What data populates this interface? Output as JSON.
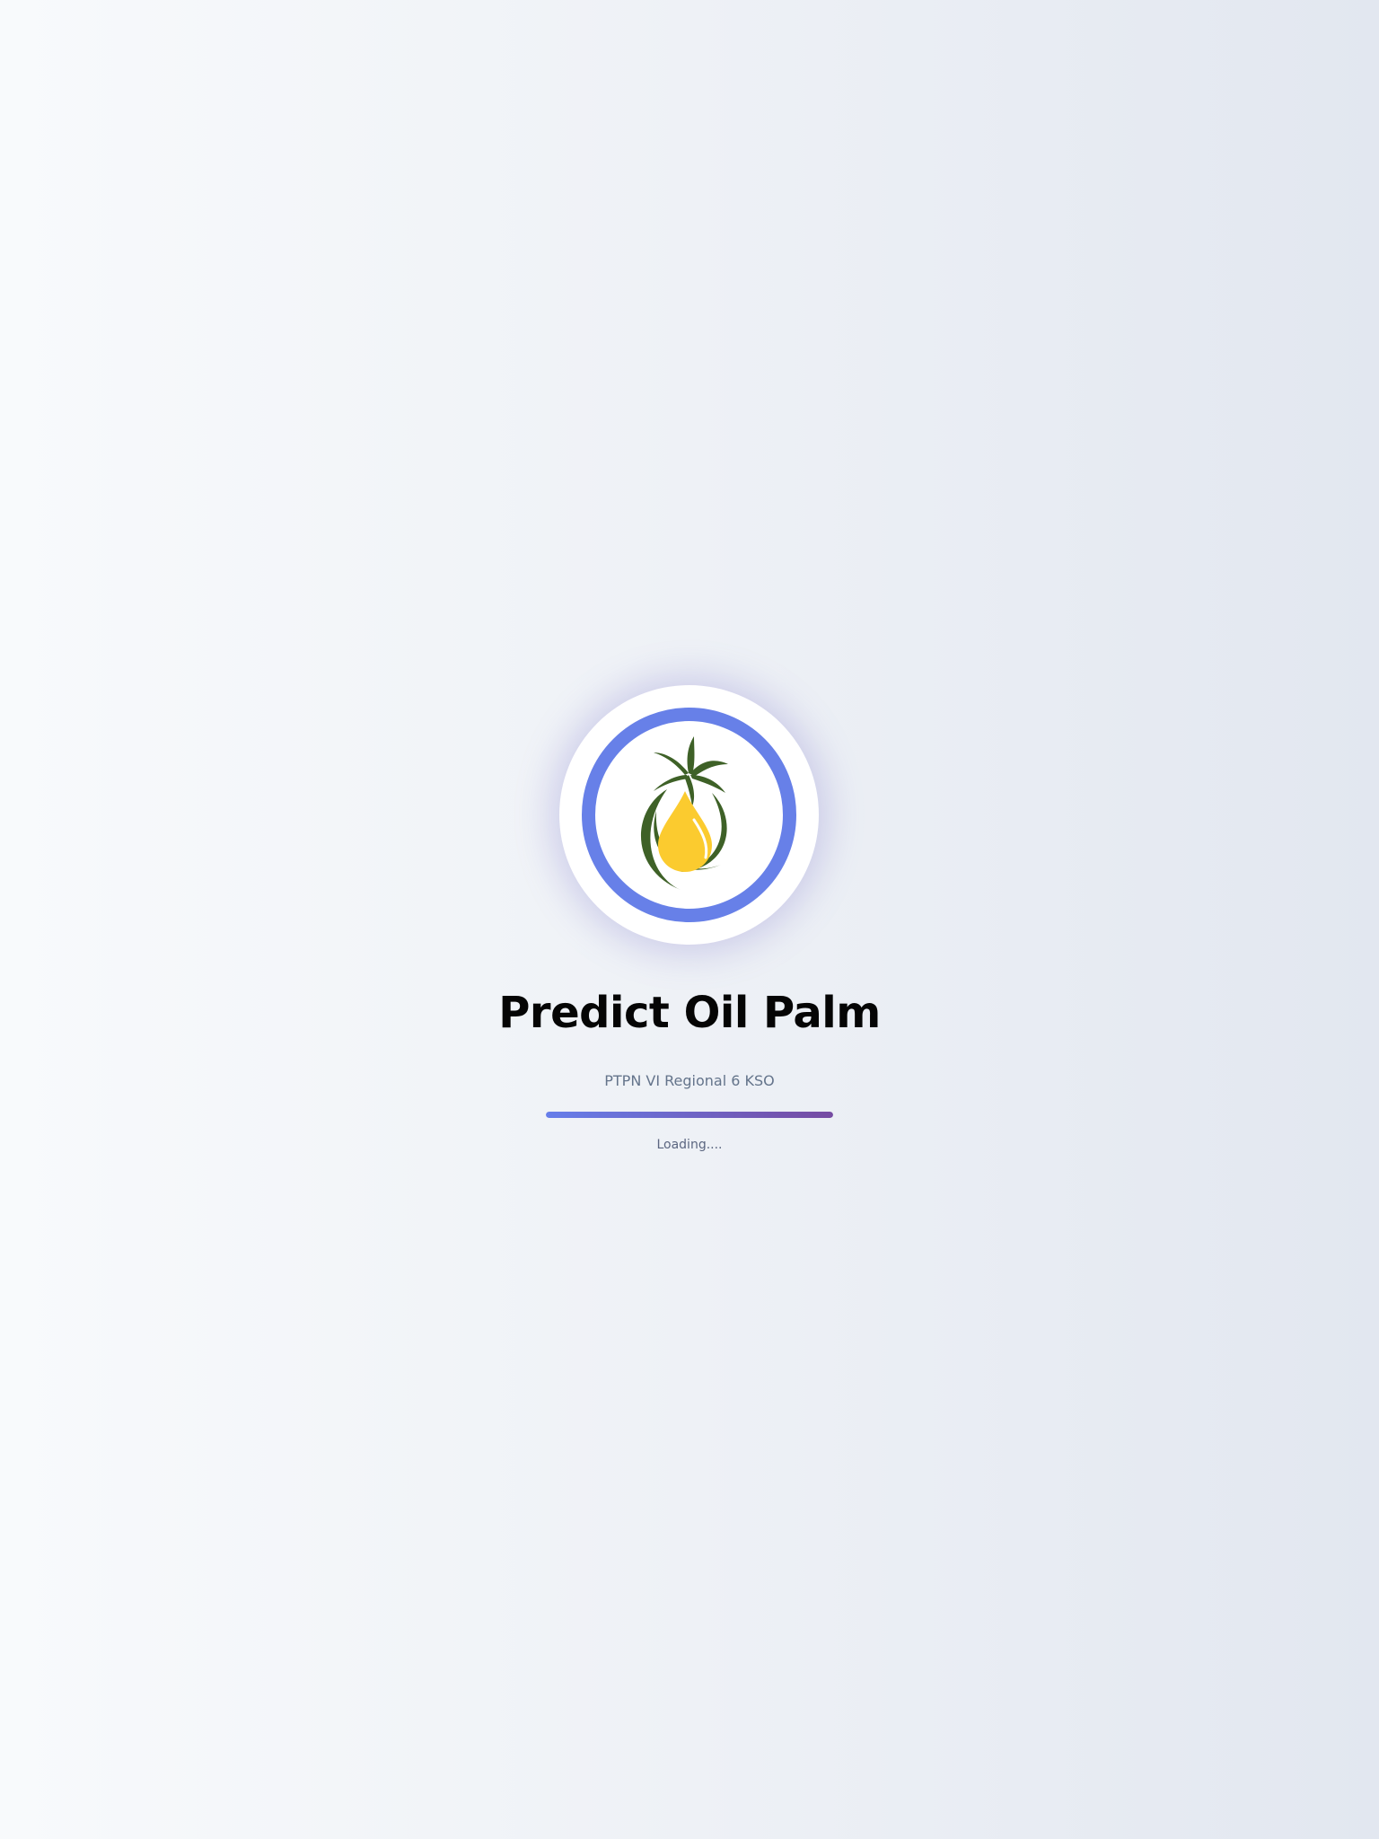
{
  "app": {
    "title": "Predict Oil Palm",
    "subtitle": "PTPN VI Regional 6 KSO",
    "loading_text": "Loading....",
    "progress_percent": 100,
    "logo_icon": "palm-tree-oil-drop",
    "colors": {
      "ring": "#6780e8",
      "progress_start": "#667eea",
      "progress_end": "#764ba2",
      "palm_green": "#3e6127",
      "oil_yellow": "#fbcb2f"
    }
  }
}
